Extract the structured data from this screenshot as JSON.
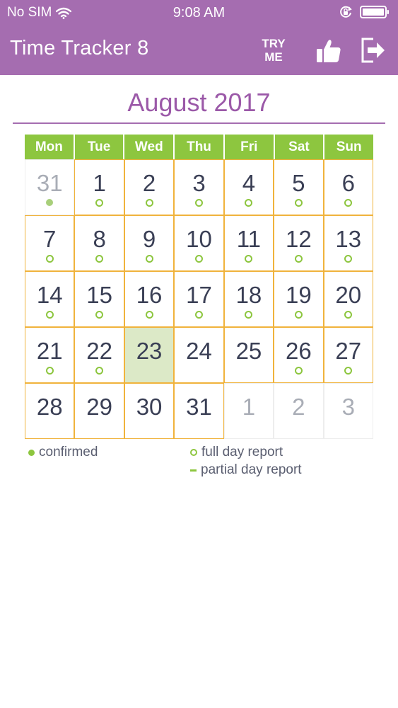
{
  "status_bar": {
    "carrier": "No SIM",
    "time": "9:08 AM"
  },
  "nav": {
    "title": "Time Tracker 8",
    "try_me_line1": "TRY",
    "try_me_line2": "ME"
  },
  "icons": {
    "wifi": "wifi-icon",
    "rotation_lock": "rotation-lock-icon",
    "battery": "battery-icon",
    "like": "thumbs-up-icon",
    "logout": "logout-icon"
  },
  "colors": {
    "header": "#a56db0",
    "weekday_header": "#8dc63f",
    "cell_border": "#f0b33c",
    "today": "#dce9c7"
  },
  "calendar": {
    "month_title": "August 2017",
    "weekdays": [
      "Mon",
      "Tue",
      "Wed",
      "Thu",
      "Fri",
      "Sat",
      "Sun"
    ],
    "days": [
      {
        "label": "31",
        "current": false,
        "marker": "confirmed"
      },
      {
        "label": "1",
        "current": true,
        "marker": "full"
      },
      {
        "label": "2",
        "current": true,
        "marker": "full"
      },
      {
        "label": "3",
        "current": true,
        "marker": "full"
      },
      {
        "label": "4",
        "current": true,
        "marker": "full"
      },
      {
        "label": "5",
        "current": true,
        "marker": "full"
      },
      {
        "label": "6",
        "current": true,
        "marker": "full"
      },
      {
        "label": "7",
        "current": true,
        "marker": "full"
      },
      {
        "label": "8",
        "current": true,
        "marker": "full"
      },
      {
        "label": "9",
        "current": true,
        "marker": "full"
      },
      {
        "label": "10",
        "current": true,
        "marker": "full"
      },
      {
        "label": "11",
        "current": true,
        "marker": "full"
      },
      {
        "label": "12",
        "current": true,
        "marker": "full"
      },
      {
        "label": "13",
        "current": true,
        "marker": "full"
      },
      {
        "label": "14",
        "current": true,
        "marker": "full"
      },
      {
        "label": "15",
        "current": true,
        "marker": "full"
      },
      {
        "label": "16",
        "current": true,
        "marker": "full"
      },
      {
        "label": "17",
        "current": true,
        "marker": "full"
      },
      {
        "label": "18",
        "current": true,
        "marker": "full"
      },
      {
        "label": "19",
        "current": true,
        "marker": "full"
      },
      {
        "label": "20",
        "current": true,
        "marker": "full"
      },
      {
        "label": "21",
        "current": true,
        "marker": "full"
      },
      {
        "label": "22",
        "current": true,
        "marker": "full"
      },
      {
        "label": "23",
        "current": true,
        "marker": "none",
        "today": true
      },
      {
        "label": "24",
        "current": true,
        "marker": "none"
      },
      {
        "label": "25",
        "current": true,
        "marker": "none"
      },
      {
        "label": "26",
        "current": true,
        "marker": "full"
      },
      {
        "label": "27",
        "current": true,
        "marker": "full"
      },
      {
        "label": "28",
        "current": true,
        "marker": "none"
      },
      {
        "label": "29",
        "current": true,
        "marker": "none"
      },
      {
        "label": "30",
        "current": true,
        "marker": "none"
      },
      {
        "label": "31",
        "current": true,
        "marker": "none"
      },
      {
        "label": "1",
        "current": false,
        "marker": "none"
      },
      {
        "label": "2",
        "current": false,
        "marker": "none"
      },
      {
        "label": "3",
        "current": false,
        "marker": "none"
      }
    ]
  },
  "legend": {
    "confirmed": "confirmed",
    "full_day": "full day report",
    "partial_day": "partial day report"
  }
}
